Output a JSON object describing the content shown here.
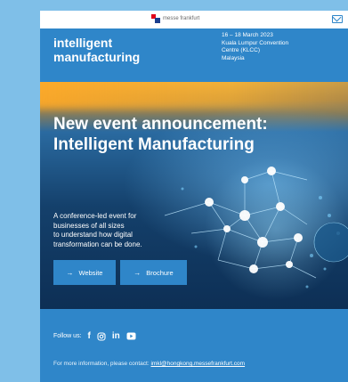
{
  "topbar": {
    "brand": "messe frankfurt"
  },
  "header": {
    "title_line1": "intelligent",
    "title_line2": "manufacturing",
    "event_lines": [
      "16 – 18 March 2023",
      "Kuala Lumpur Convention",
      "Centre (KLCC)",
      "Malaysia"
    ]
  },
  "hero": {
    "title_line1": "New event announcement:",
    "title_line2": "Intelligent Manufacturing",
    "desc_lines": [
      "A conference-led event  for",
      "businesses of all sizes",
      "to understand how digital",
      "transformation can be done."
    ],
    "buttons": {
      "website": "Website",
      "brochure": "Brochure"
    }
  },
  "footer": {
    "follow_label": "Follow us:",
    "social_icons": [
      "facebook-icon",
      "instagram-icon",
      "linkedin-icon",
      "youtube-icon"
    ],
    "contact_text": "For more information, please contact:",
    "contact_email": "imkl@hongkong.messefrankfurt.com"
  },
  "colors": {
    "page_bg": "#7fbfe8",
    "email_blue": "#2f86c9",
    "hero_dark": "#14406b",
    "hero_orange": "#e9a12a"
  }
}
